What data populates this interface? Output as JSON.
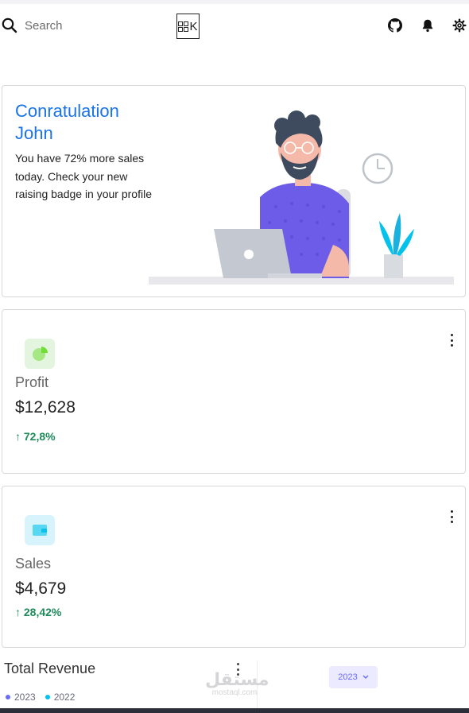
{
  "header": {
    "search_placeholder": "Search",
    "logo_letter": "K"
  },
  "hero": {
    "title": "Conratulation John",
    "text": "You have 72% more sales today. Check your new raising badge in your profile"
  },
  "profit": {
    "label": "Profit",
    "value": "$12,628",
    "change": "↑ 72,8%"
  },
  "sales": {
    "label": "Sales",
    "value": "$4,679",
    "change": "↑ 28,42%"
  },
  "revenue": {
    "title": "Total Revenue",
    "legend": [
      {
        "label": "2023",
        "color": "#696cff"
      },
      {
        "label": "2022",
        "color": "#03c3ec"
      }
    ],
    "year_select": "2023"
  },
  "watermark": {
    "main": "مستقل",
    "sub": "mostaql.com"
  },
  "colors": {
    "accent": "#1a73e8",
    "positive": "#1e8a5a",
    "primary": "#696cff"
  }
}
